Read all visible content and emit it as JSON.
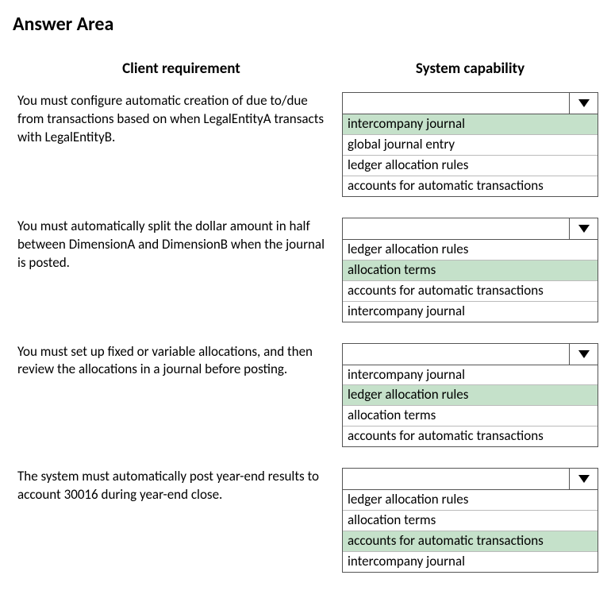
{
  "title": "Answer Area",
  "headers": {
    "left": "Client requirement",
    "right": "System capability"
  },
  "rows": [
    {
      "requirement": "You must configure automatic creation of due to/due from transactions based on when LegalEntityA transacts with LegalEntityB.",
      "selected": "",
      "options": [
        {
          "label": "intercompany journal",
          "highlighted": true
        },
        {
          "label": "global journal entry",
          "highlighted": false
        },
        {
          "label": "ledger allocation rules",
          "highlighted": false
        },
        {
          "label": "accounts for automatic transactions",
          "highlighted": false
        }
      ]
    },
    {
      "requirement": "You must automatically split the dollar amount in half between DimensionA and DimensionB when the journal is posted.",
      "selected": "",
      "options": [
        {
          "label": "ledger allocation rules",
          "highlighted": false
        },
        {
          "label": "allocation terms",
          "highlighted": true
        },
        {
          "label": "accounts for automatic transactions",
          "highlighted": false
        },
        {
          "label": "intercompany journal",
          "highlighted": false
        }
      ]
    },
    {
      "requirement": "You must set up fixed or variable allocations, and then review the allocations in a journal before posting.",
      "selected": "",
      "options": [
        {
          "label": "intercompany journal",
          "highlighted": false
        },
        {
          "label": "ledger allocation rules",
          "highlighted": true
        },
        {
          "label": "allocation terms",
          "highlighted": false
        },
        {
          "label": "accounts for automatic transactions",
          "highlighted": false
        }
      ]
    },
    {
      "requirement": "The system must automatically post year-end results to account 30016 during year-end close.",
      "selected": "",
      "options": [
        {
          "label": "ledger allocation rules",
          "highlighted": false
        },
        {
          "label": "allocation terms",
          "highlighted": false
        },
        {
          "label": "accounts for automatic transactions",
          "highlighted": true
        },
        {
          "label": "intercompany journal",
          "highlighted": false
        }
      ]
    }
  ]
}
